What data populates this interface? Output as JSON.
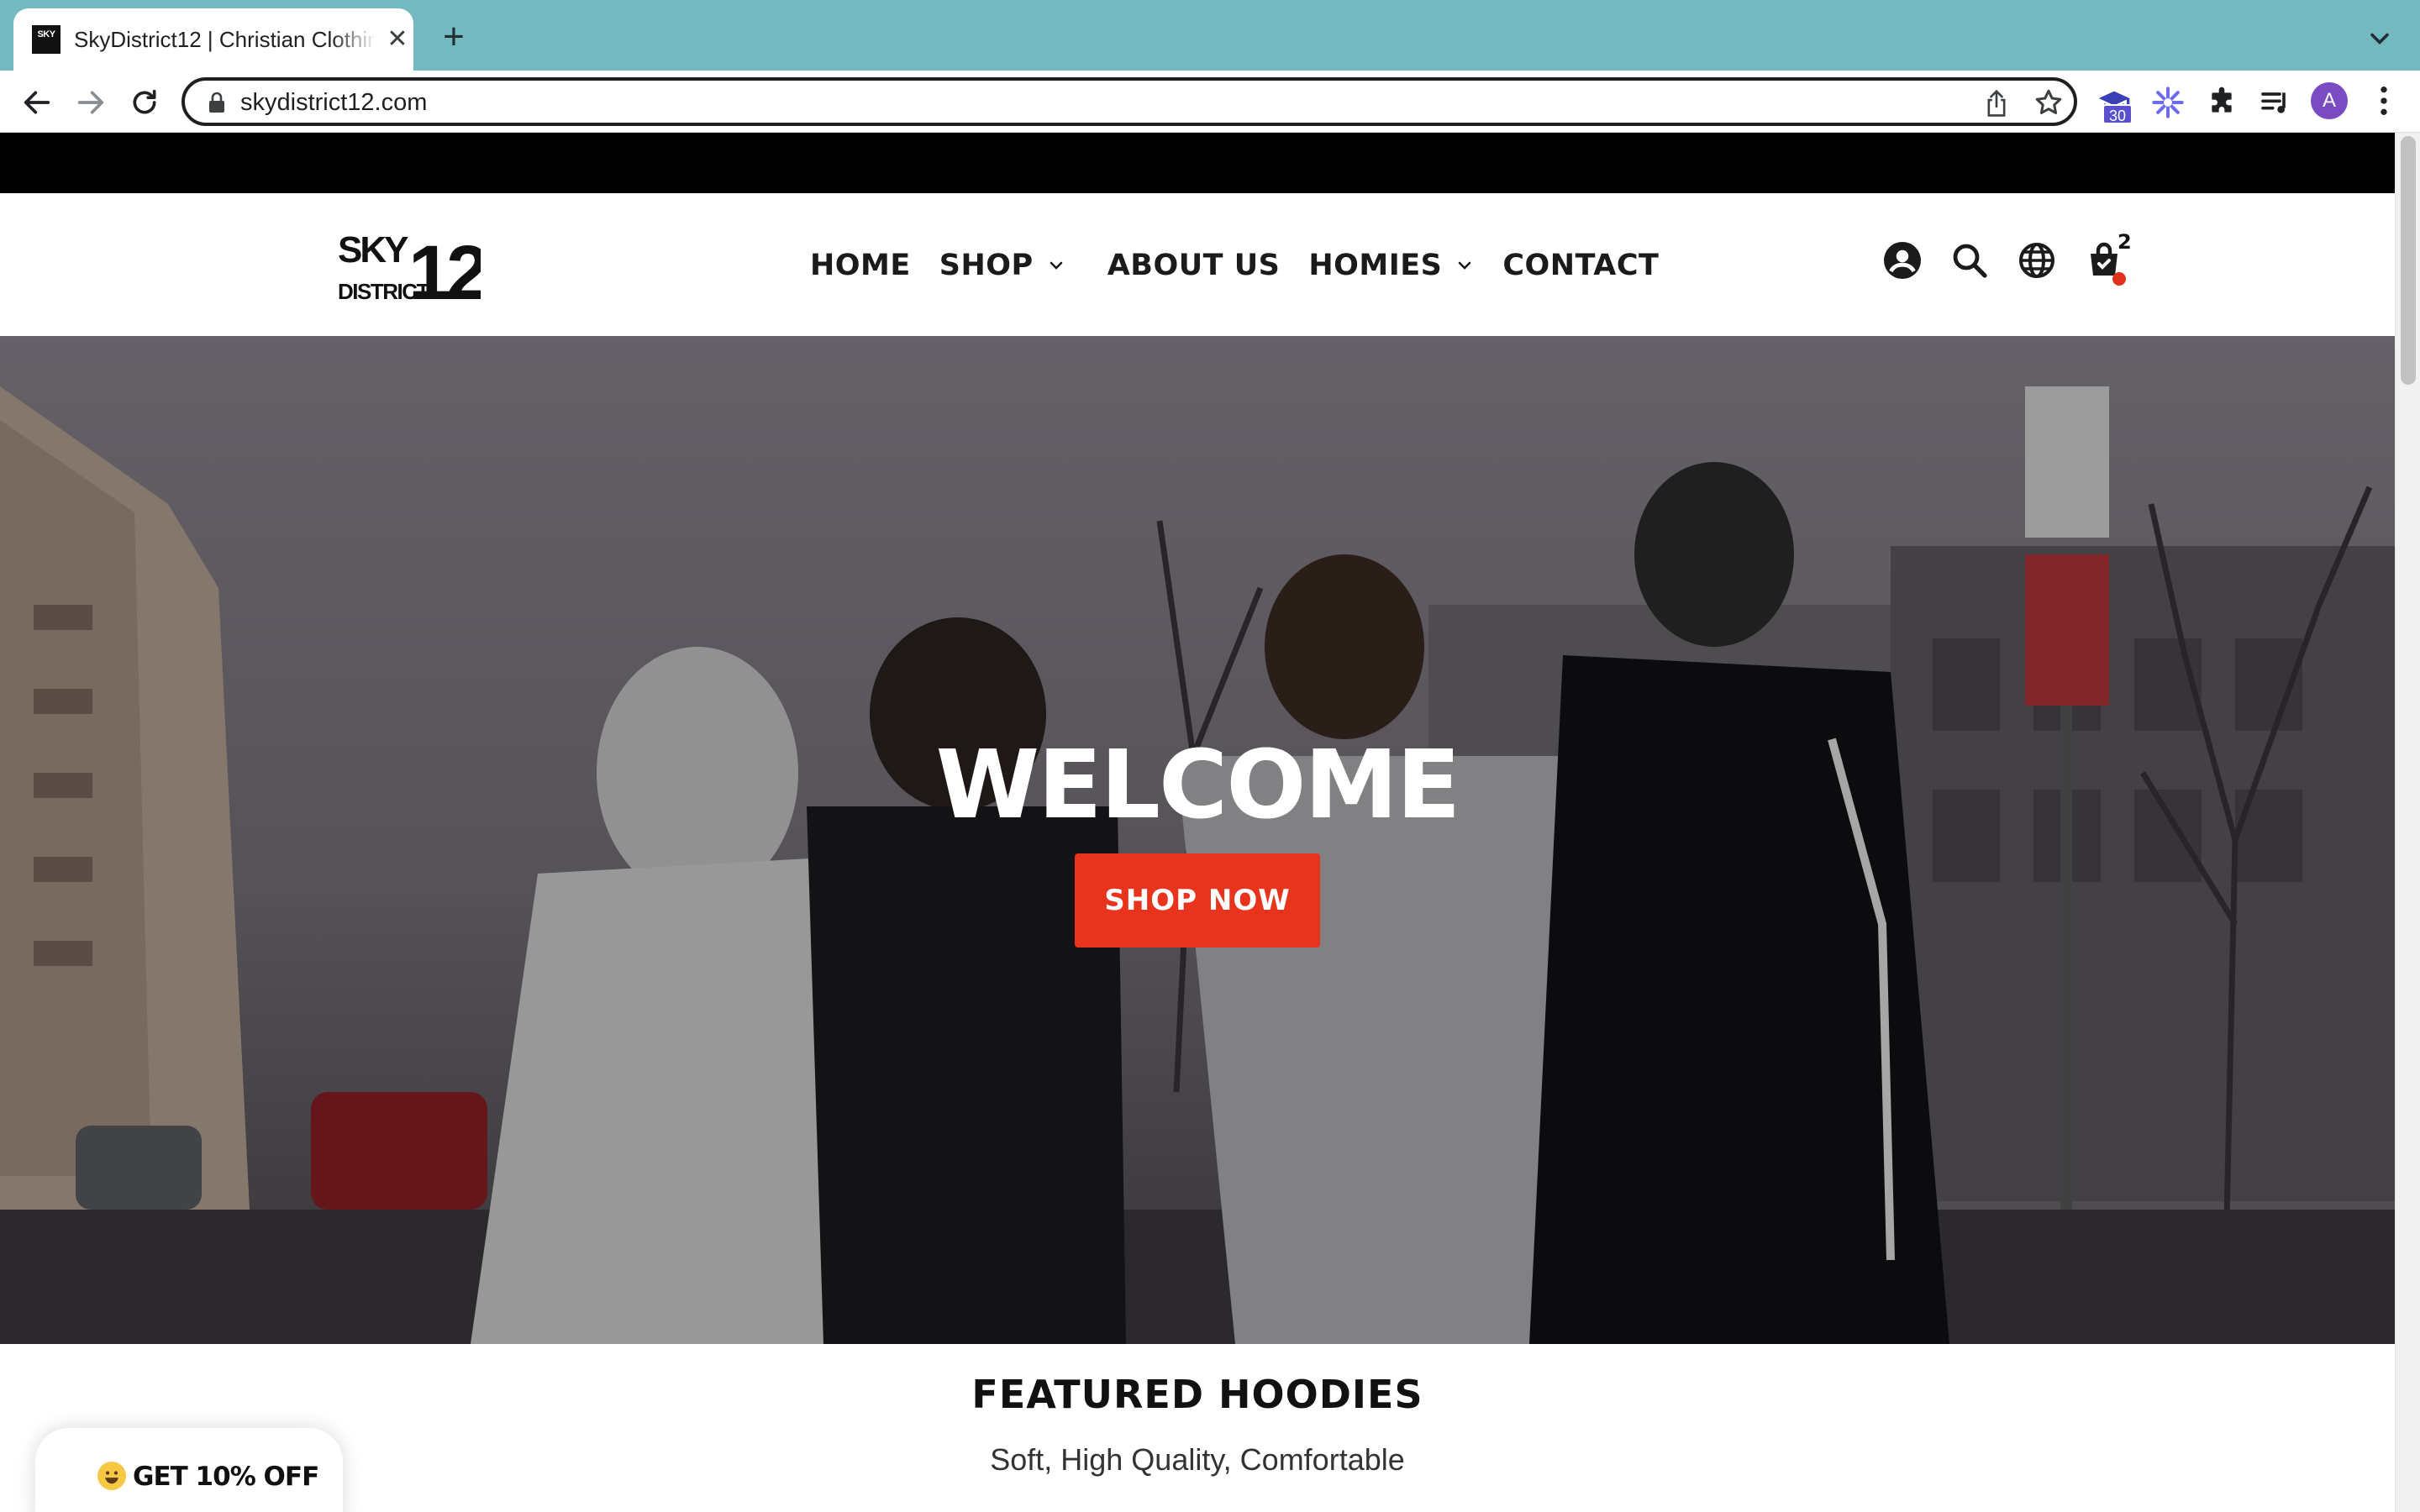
{
  "browser": {
    "tab_title": "SkyDistrict12 | Christian Clothing",
    "favicon_text": "SKY",
    "url": "skydistrict12.com",
    "extension_badge": "30",
    "profile_initial": "A"
  },
  "site": {
    "nav": {
      "items": [
        {
          "label": "HOME",
          "has_dropdown": false
        },
        {
          "label": "SHOP",
          "has_dropdown": true
        },
        {
          "label": "ABOUT US",
          "has_dropdown": false
        },
        {
          "label": "HOMIES",
          "has_dropdown": true
        },
        {
          "label": "CONTACT",
          "has_dropdown": false
        }
      ]
    },
    "cart_count": "2",
    "icons": [
      "account-icon",
      "search-icon",
      "globe-icon",
      "cart-icon"
    ]
  },
  "hero": {
    "title": "WELCOME",
    "button_label": "SHOP NOW"
  },
  "featured": {
    "title": "FEATURED HOODIES",
    "subtitle": "Soft, High Quality, Comfortable"
  },
  "popup": {
    "label": "GET 10% OFF"
  },
  "colors": {
    "tab_strip": "#74b8c1",
    "accent": "#e8341c",
    "announcement_bar": "#000000"
  }
}
